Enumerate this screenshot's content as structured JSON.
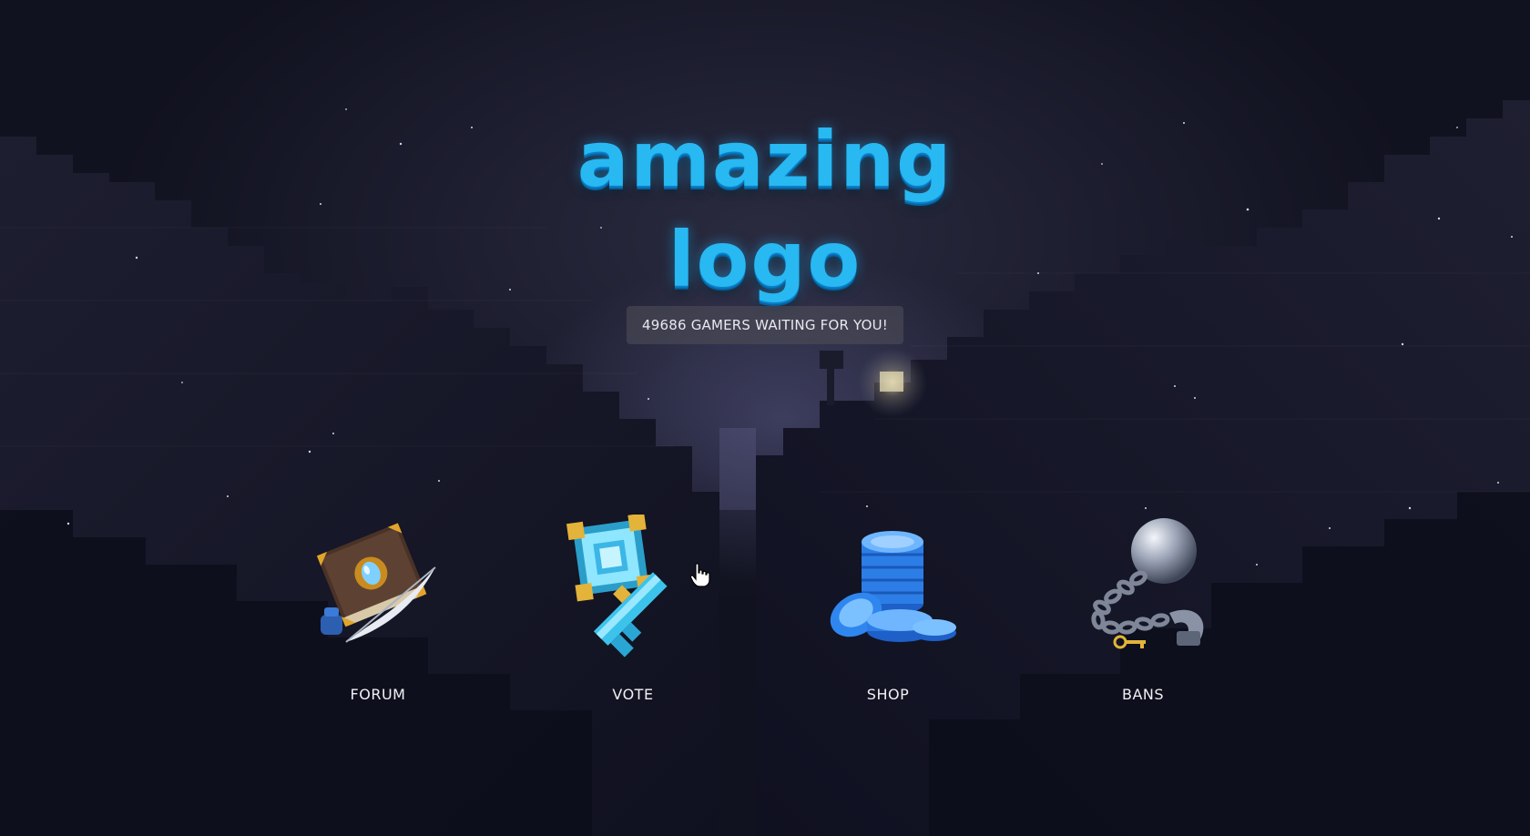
{
  "logo": {
    "text": "amazing logo",
    "color": "#28b8f2"
  },
  "counter": {
    "text": "49686 GAMERS WAITING FOR YOU!"
  },
  "nav": {
    "items": [
      {
        "label": "FORUM",
        "icon": "book-quill-icon"
      },
      {
        "label": "VOTE",
        "icon": "key-icon"
      },
      {
        "label": "SHOP",
        "icon": "coins-icon"
      },
      {
        "label": "BANS",
        "icon": "ball-and-chain-icon"
      }
    ]
  },
  "cursor": {
    "icon": "hand-pointer-icon"
  },
  "colors": {
    "background": "#0f1020",
    "label_text": "#f0f0f4",
    "counter_bg": "rgba(80,80,90,0.55)"
  }
}
